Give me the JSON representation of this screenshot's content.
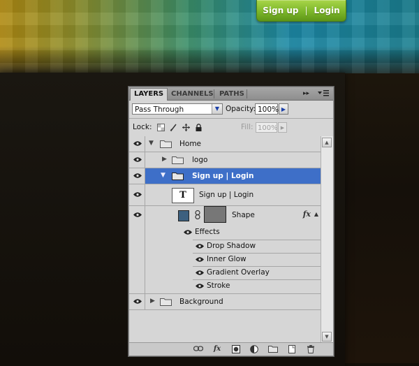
{
  "nav": {
    "signup": "Sign up",
    "separator": "|",
    "login": "Login"
  },
  "colors": {
    "nav_green": "#7cb62a",
    "selection_blue": "#3e6fc8",
    "shape_fill": "#3d607f"
  },
  "panel": {
    "tabs": [
      {
        "label": "LAYERS",
        "active": true
      },
      {
        "label": "CHANNELS",
        "active": false
      },
      {
        "label": "PATHS",
        "active": false
      }
    ],
    "menu_glyph": "▸▸",
    "menu_icon": "panel-menu-icon",
    "blend_mode": "Pass Through",
    "opacity_label": "Opacity:",
    "opacity_value": "100%",
    "lock_label": "Lock:",
    "lock_icons": [
      "lock-transparent-icon",
      "lock-image-icon",
      "lock-position-icon",
      "lock-all-icon"
    ],
    "fill_label": "Fill:",
    "fill_value": "100%",
    "layers": {
      "home": "Home",
      "logo": "logo",
      "signup_group": "Sign up   |   Login",
      "text_layer": "Sign up   |   Login",
      "text_thumb": "T",
      "shape": "Shape",
      "fx_badge": "fx",
      "effects": "Effects",
      "effect_items": [
        "Drop Shadow",
        "Inner Glow",
        "Gradient Overlay",
        "Stroke"
      ],
      "background": "Background"
    },
    "footer_icons": [
      "link-layers-icon",
      "fx-icon",
      "mask-icon",
      "adjustment-icon",
      "new-group-icon",
      "new-layer-icon",
      "trash-icon"
    ]
  }
}
